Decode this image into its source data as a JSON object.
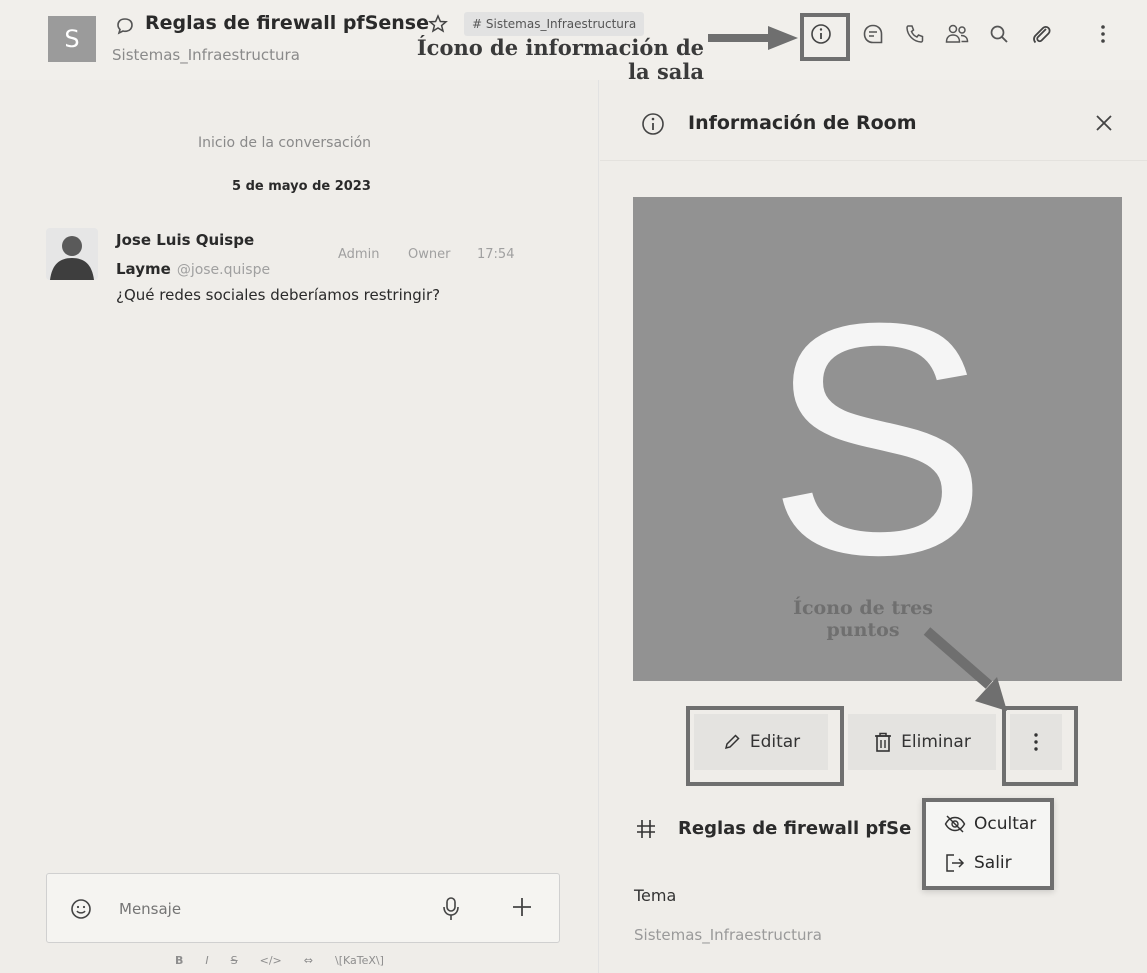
{
  "header": {
    "room_avatar_letter": "S",
    "room_title": "Reglas de firewall pfSense",
    "room_subtitle": "Sistemas_Infraestructura",
    "team_tag": "# Sistemas_Infraestructura",
    "annotation_info": "Ícono de información de la sala"
  },
  "chat": {
    "conversation_start": "Inicio de la conversación",
    "date": "5 de mayo de 2023",
    "message": {
      "author_line1": "Jose Luis Quispe",
      "author_line2": "Layme",
      "username": "@jose.quispe",
      "role_admin": "Admin",
      "role_owner": "Owner",
      "time": "17:54",
      "text": "¿Qué redes sociales deberíamos restringir?"
    },
    "composer": {
      "placeholder": "Mensaje",
      "format_bold": "B",
      "format_italic": "I",
      "format_strike": "S",
      "format_code": "</>",
      "format_link": "⇔",
      "format_katex": "\\[KaTeX\\]"
    }
  },
  "panel": {
    "title": "Información de Room",
    "avatar_letter": "S",
    "annotation_more": "Ícono de tres puntos",
    "edit_label": "Editar",
    "delete_label": "Eliminar",
    "room_name": "Reglas de firewall pfSe",
    "topic_label": "Tema",
    "topic_value": "Sistemas_Infraestructura",
    "menu": {
      "hide_label": "Ocultar",
      "leave_label": "Salir"
    }
  }
}
